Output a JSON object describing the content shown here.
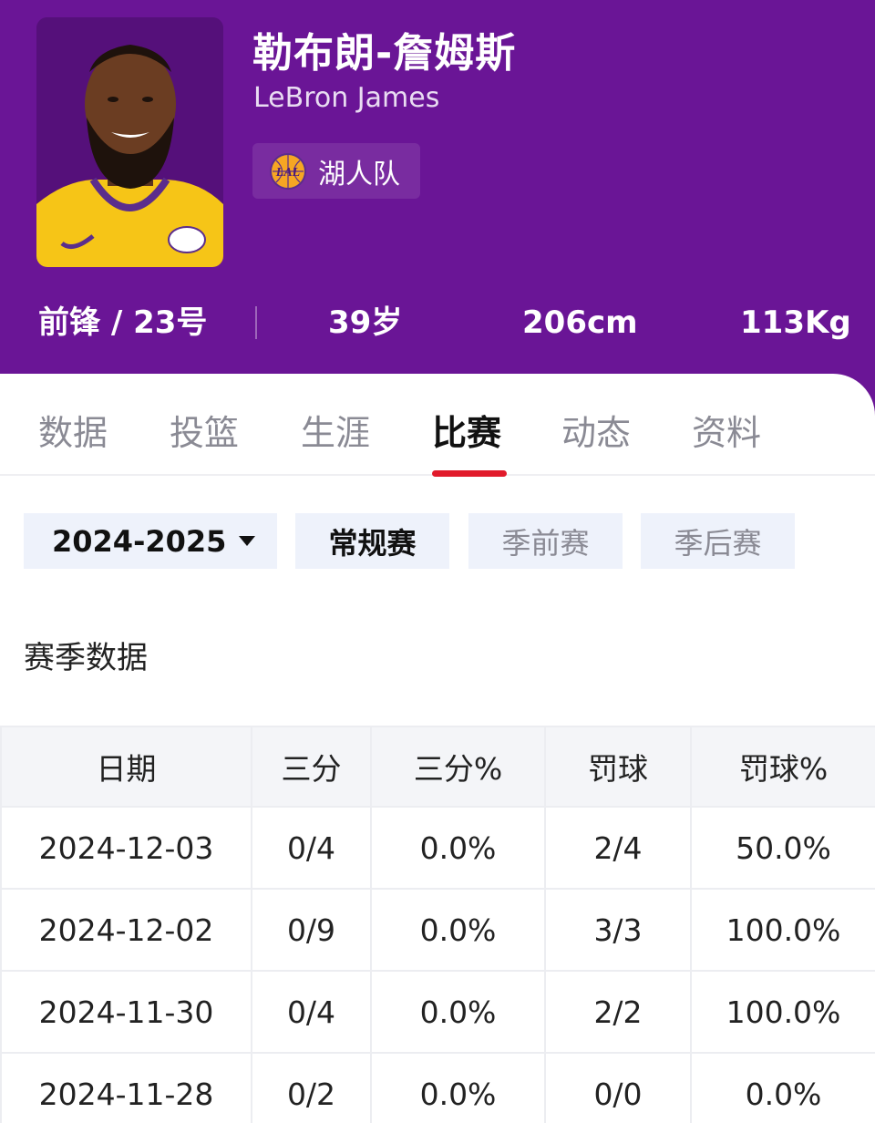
{
  "player": {
    "name_cn": "勒布朗-詹姆斯",
    "name_en": "LeBron James",
    "team": "湖人队",
    "team_logo_text": "LAL",
    "position_number": "前锋 / 23号",
    "age": "39岁",
    "height": "206cm",
    "weight": "113Kg"
  },
  "colors": {
    "header_bg": "#6a1596",
    "tab_accent": "#e11a2b",
    "jersey": "#f6c517"
  },
  "tabs": [
    {
      "label": "数据"
    },
    {
      "label": "投篮"
    },
    {
      "label": "生涯"
    },
    {
      "label": "比赛",
      "active": true
    },
    {
      "label": "动态"
    },
    {
      "label": "资料"
    }
  ],
  "filters": {
    "season": "2024-2025",
    "types": [
      {
        "label": "常规赛",
        "active": true
      },
      {
        "label": "季前赛",
        "active": false
      },
      {
        "label": "季后赛",
        "active": false
      }
    ]
  },
  "section_title": "赛季数据",
  "table": {
    "headers": [
      "日期",
      "三分",
      "三分%",
      "罚球",
      "罚球%"
    ],
    "rows": [
      [
        "2024-12-03",
        "0/4",
        "0.0%",
        "2/4",
        "50.0%"
      ],
      [
        "2024-12-02",
        "0/9",
        "0.0%",
        "3/3",
        "100.0%"
      ],
      [
        "2024-11-30",
        "0/4",
        "0.0%",
        "2/2",
        "100.0%"
      ],
      [
        "2024-11-28",
        "0/2",
        "0.0%",
        "0/0",
        "0.0%"
      ]
    ]
  }
}
